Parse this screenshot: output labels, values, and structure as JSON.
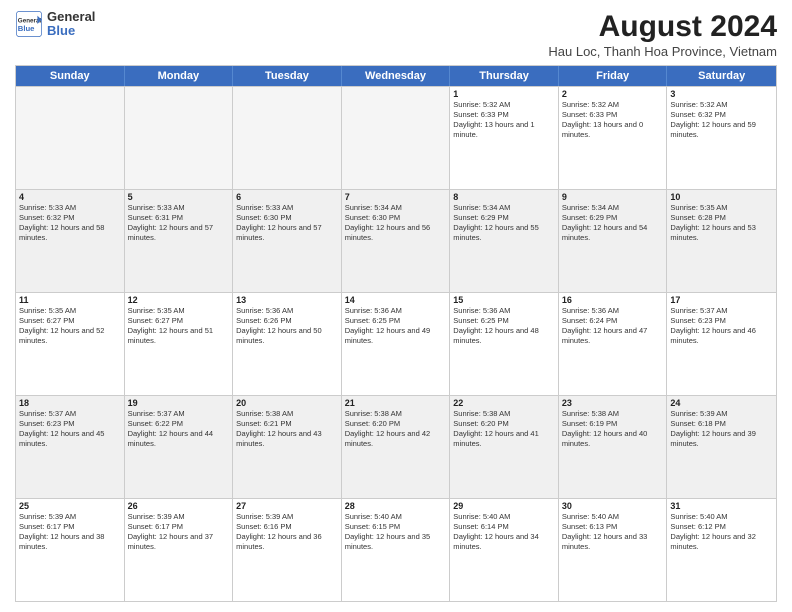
{
  "header": {
    "logo": {
      "general": "General",
      "blue": "Blue"
    },
    "title": "August 2024",
    "subtitle": "Hau Loc, Thanh Hoa Province, Vietnam"
  },
  "calendar": {
    "days_of_week": [
      "Sunday",
      "Monday",
      "Tuesday",
      "Wednesday",
      "Thursday",
      "Friday",
      "Saturday"
    ],
    "rows": [
      [
        {
          "day": "",
          "empty": true
        },
        {
          "day": "",
          "empty": true
        },
        {
          "day": "",
          "empty": true
        },
        {
          "day": "",
          "empty": true
        },
        {
          "day": "1",
          "sunrise": "5:32 AM",
          "sunset": "6:33 PM",
          "daylight": "13 hours and 1 minute."
        },
        {
          "day": "2",
          "sunrise": "5:32 AM",
          "sunset": "6:33 PM",
          "daylight": "13 hours and 0 minutes."
        },
        {
          "day": "3",
          "sunrise": "5:32 AM",
          "sunset": "6:32 PM",
          "daylight": "12 hours and 59 minutes."
        }
      ],
      [
        {
          "day": "4",
          "sunrise": "5:33 AM",
          "sunset": "6:32 PM",
          "daylight": "12 hours and 58 minutes."
        },
        {
          "day": "5",
          "sunrise": "5:33 AM",
          "sunset": "6:31 PM",
          "daylight": "12 hours and 57 minutes."
        },
        {
          "day": "6",
          "sunrise": "5:33 AM",
          "sunset": "6:30 PM",
          "daylight": "12 hours and 57 minutes."
        },
        {
          "day": "7",
          "sunrise": "5:34 AM",
          "sunset": "6:30 PM",
          "daylight": "12 hours and 56 minutes."
        },
        {
          "day": "8",
          "sunrise": "5:34 AM",
          "sunset": "6:29 PM",
          "daylight": "12 hours and 55 minutes."
        },
        {
          "day": "9",
          "sunrise": "5:34 AM",
          "sunset": "6:29 PM",
          "daylight": "12 hours and 54 minutes."
        },
        {
          "day": "10",
          "sunrise": "5:35 AM",
          "sunset": "6:28 PM",
          "daylight": "12 hours and 53 minutes."
        }
      ],
      [
        {
          "day": "11",
          "sunrise": "5:35 AM",
          "sunset": "6:27 PM",
          "daylight": "12 hours and 52 minutes."
        },
        {
          "day": "12",
          "sunrise": "5:35 AM",
          "sunset": "6:27 PM",
          "daylight": "12 hours and 51 minutes."
        },
        {
          "day": "13",
          "sunrise": "5:36 AM",
          "sunset": "6:26 PM",
          "daylight": "12 hours and 50 minutes."
        },
        {
          "day": "14",
          "sunrise": "5:36 AM",
          "sunset": "6:25 PM",
          "daylight": "12 hours and 49 minutes."
        },
        {
          "day": "15",
          "sunrise": "5:36 AM",
          "sunset": "6:25 PM",
          "daylight": "12 hours and 48 minutes."
        },
        {
          "day": "16",
          "sunrise": "5:36 AM",
          "sunset": "6:24 PM",
          "daylight": "12 hours and 47 minutes."
        },
        {
          "day": "17",
          "sunrise": "5:37 AM",
          "sunset": "6:23 PM",
          "daylight": "12 hours and 46 minutes."
        }
      ],
      [
        {
          "day": "18",
          "sunrise": "5:37 AM",
          "sunset": "6:23 PM",
          "daylight": "12 hours and 45 minutes."
        },
        {
          "day": "19",
          "sunrise": "5:37 AM",
          "sunset": "6:22 PM",
          "daylight": "12 hours and 44 minutes."
        },
        {
          "day": "20",
          "sunrise": "5:38 AM",
          "sunset": "6:21 PM",
          "daylight": "12 hours and 43 minutes."
        },
        {
          "day": "21",
          "sunrise": "5:38 AM",
          "sunset": "6:20 PM",
          "daylight": "12 hours and 42 minutes."
        },
        {
          "day": "22",
          "sunrise": "5:38 AM",
          "sunset": "6:20 PM",
          "daylight": "12 hours and 41 minutes."
        },
        {
          "day": "23",
          "sunrise": "5:38 AM",
          "sunset": "6:19 PM",
          "daylight": "12 hours and 40 minutes."
        },
        {
          "day": "24",
          "sunrise": "5:39 AM",
          "sunset": "6:18 PM",
          "daylight": "12 hours and 39 minutes."
        }
      ],
      [
        {
          "day": "25",
          "sunrise": "5:39 AM",
          "sunset": "6:17 PM",
          "daylight": "12 hours and 38 minutes."
        },
        {
          "day": "26",
          "sunrise": "5:39 AM",
          "sunset": "6:17 PM",
          "daylight": "12 hours and 37 minutes."
        },
        {
          "day": "27",
          "sunrise": "5:39 AM",
          "sunset": "6:16 PM",
          "daylight": "12 hours and 36 minutes."
        },
        {
          "day": "28",
          "sunrise": "5:40 AM",
          "sunset": "6:15 PM",
          "daylight": "12 hours and 35 minutes."
        },
        {
          "day": "29",
          "sunrise": "5:40 AM",
          "sunset": "6:14 PM",
          "daylight": "12 hours and 34 minutes."
        },
        {
          "day": "30",
          "sunrise": "5:40 AM",
          "sunset": "6:13 PM",
          "daylight": "12 hours and 33 minutes."
        },
        {
          "day": "31",
          "sunrise": "5:40 AM",
          "sunset": "6:12 PM",
          "daylight": "12 hours and 32 minutes."
        }
      ]
    ]
  }
}
